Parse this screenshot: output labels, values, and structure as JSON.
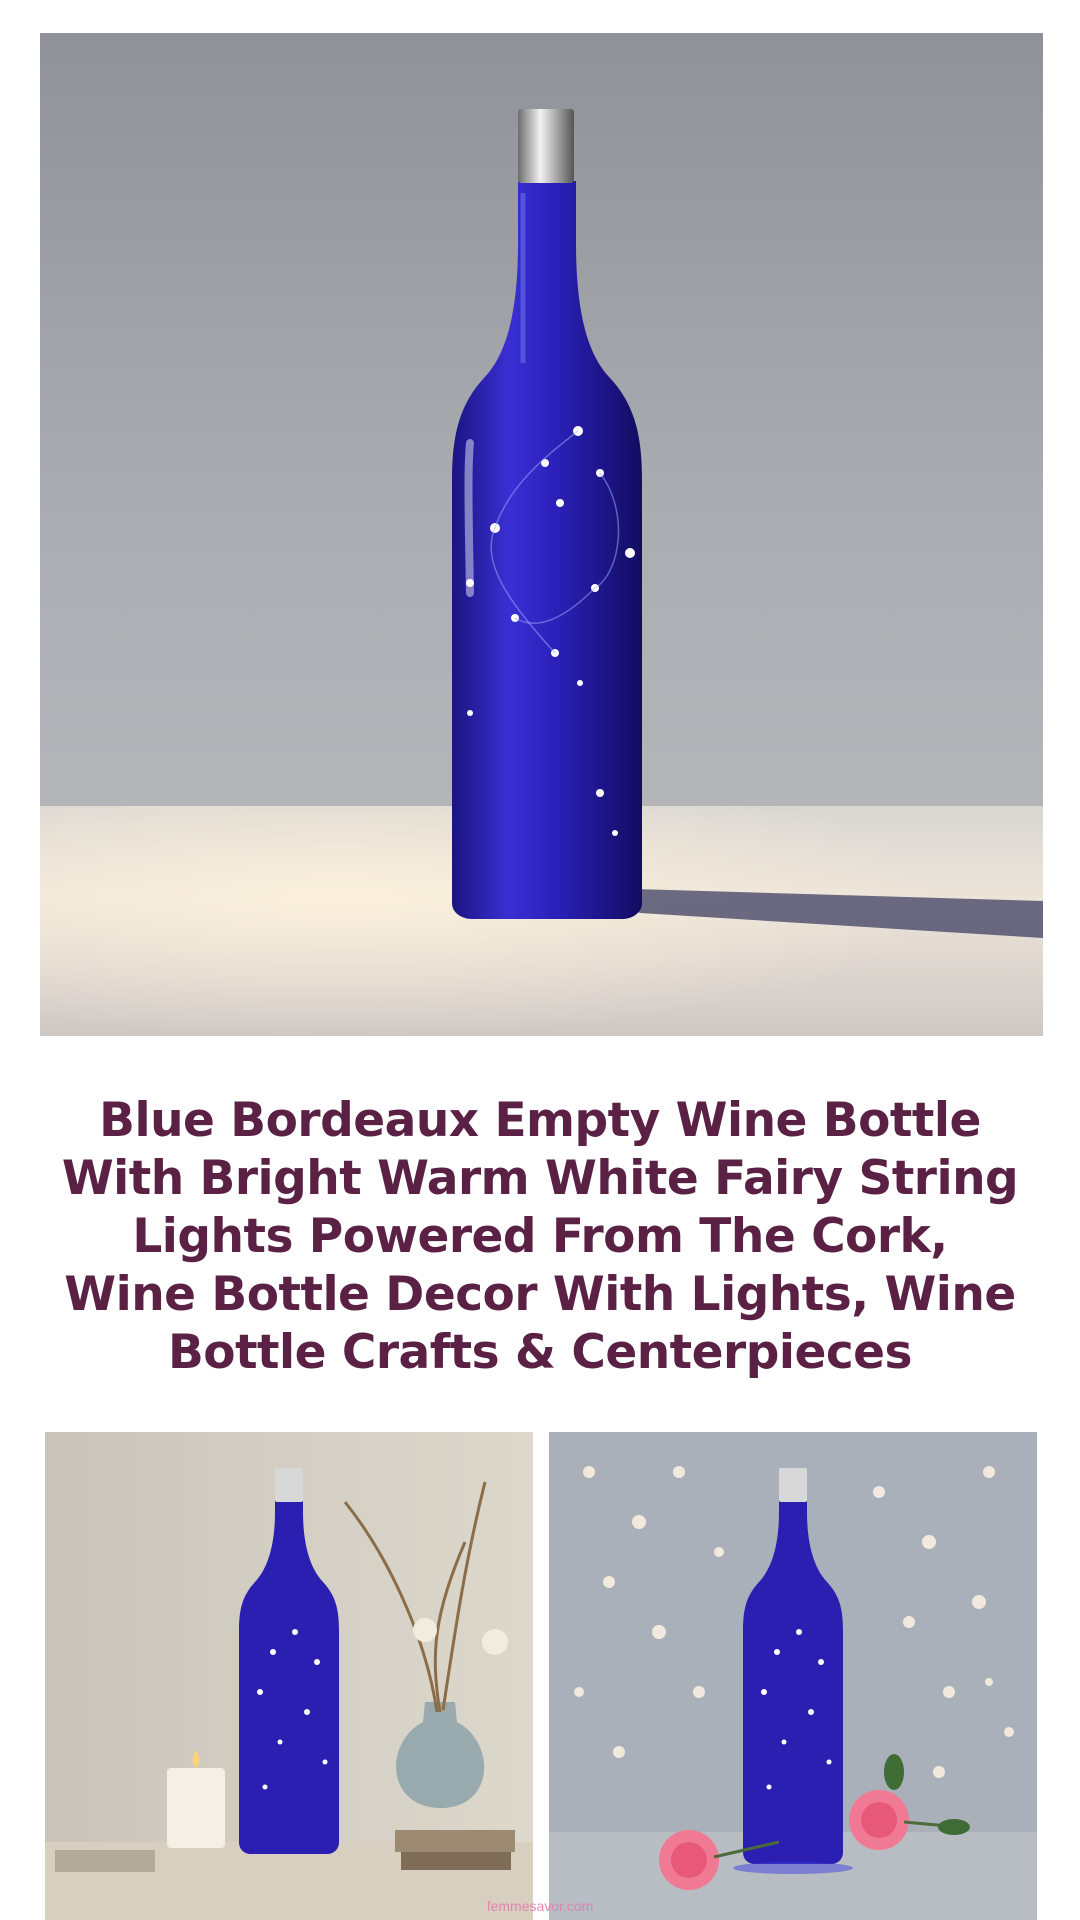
{
  "article": {
    "title": "Blue Bordeaux Empty Wine Bottle With Bright Warm White Fairy String Lights Powered From The Cork, Wine Bottle Decor With Lights, Wine Bottle Crafts & Centerpieces"
  },
  "images": {
    "hero": {
      "subject": "cobalt blue wine bottle with fairy lights on table"
    },
    "left": {
      "subject": "blue bottle with candle, dried flowers and glass vase"
    },
    "right": {
      "subject": "blue bottle with pink roses and bokeh lights"
    }
  },
  "watermark": "femmesavor.com",
  "colors": {
    "title": "#5b2145",
    "bottle": "#2a1fb0",
    "watermark": "#e07fb0"
  }
}
